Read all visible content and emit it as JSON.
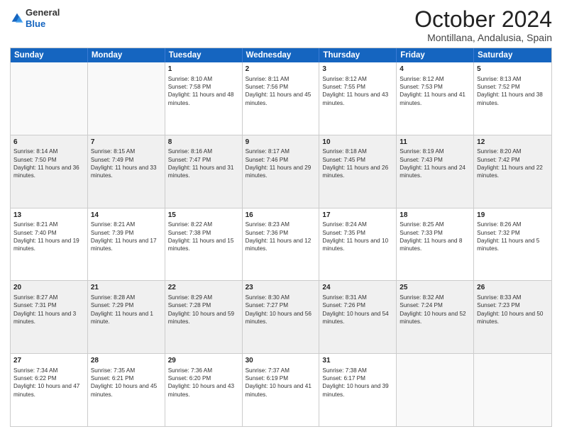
{
  "header": {
    "logo_general": "General",
    "logo_blue": "Blue",
    "month_title": "October 2024",
    "location": "Montillana, Andalusia, Spain"
  },
  "days_of_week": [
    "Sunday",
    "Monday",
    "Tuesday",
    "Wednesday",
    "Thursday",
    "Friday",
    "Saturday"
  ],
  "weeks": [
    [
      {
        "day": "",
        "sunrise": "",
        "sunset": "",
        "daylight": "",
        "shaded": false,
        "empty": true
      },
      {
        "day": "",
        "sunrise": "",
        "sunset": "",
        "daylight": "",
        "shaded": false,
        "empty": true
      },
      {
        "day": "1",
        "sunrise": "Sunrise: 8:10 AM",
        "sunset": "Sunset: 7:58 PM",
        "daylight": "Daylight: 11 hours and 48 minutes.",
        "shaded": false,
        "empty": false
      },
      {
        "day": "2",
        "sunrise": "Sunrise: 8:11 AM",
        "sunset": "Sunset: 7:56 PM",
        "daylight": "Daylight: 11 hours and 45 minutes.",
        "shaded": false,
        "empty": false
      },
      {
        "day": "3",
        "sunrise": "Sunrise: 8:12 AM",
        "sunset": "Sunset: 7:55 PM",
        "daylight": "Daylight: 11 hours and 43 minutes.",
        "shaded": false,
        "empty": false
      },
      {
        "day": "4",
        "sunrise": "Sunrise: 8:12 AM",
        "sunset": "Sunset: 7:53 PM",
        "daylight": "Daylight: 11 hours and 41 minutes.",
        "shaded": false,
        "empty": false
      },
      {
        "day": "5",
        "sunrise": "Sunrise: 8:13 AM",
        "sunset": "Sunset: 7:52 PM",
        "daylight": "Daylight: 11 hours and 38 minutes.",
        "shaded": false,
        "empty": false
      }
    ],
    [
      {
        "day": "6",
        "sunrise": "Sunrise: 8:14 AM",
        "sunset": "Sunset: 7:50 PM",
        "daylight": "Daylight: 11 hours and 36 minutes.",
        "shaded": true,
        "empty": false
      },
      {
        "day": "7",
        "sunrise": "Sunrise: 8:15 AM",
        "sunset": "Sunset: 7:49 PM",
        "daylight": "Daylight: 11 hours and 33 minutes.",
        "shaded": true,
        "empty": false
      },
      {
        "day": "8",
        "sunrise": "Sunrise: 8:16 AM",
        "sunset": "Sunset: 7:47 PM",
        "daylight": "Daylight: 11 hours and 31 minutes.",
        "shaded": true,
        "empty": false
      },
      {
        "day": "9",
        "sunrise": "Sunrise: 8:17 AM",
        "sunset": "Sunset: 7:46 PM",
        "daylight": "Daylight: 11 hours and 29 minutes.",
        "shaded": true,
        "empty": false
      },
      {
        "day": "10",
        "sunrise": "Sunrise: 8:18 AM",
        "sunset": "Sunset: 7:45 PM",
        "daylight": "Daylight: 11 hours and 26 minutes.",
        "shaded": true,
        "empty": false
      },
      {
        "day": "11",
        "sunrise": "Sunrise: 8:19 AM",
        "sunset": "Sunset: 7:43 PM",
        "daylight": "Daylight: 11 hours and 24 minutes.",
        "shaded": true,
        "empty": false
      },
      {
        "day": "12",
        "sunrise": "Sunrise: 8:20 AM",
        "sunset": "Sunset: 7:42 PM",
        "daylight": "Daylight: 11 hours and 22 minutes.",
        "shaded": true,
        "empty": false
      }
    ],
    [
      {
        "day": "13",
        "sunrise": "Sunrise: 8:21 AM",
        "sunset": "Sunset: 7:40 PM",
        "daylight": "Daylight: 11 hours and 19 minutes.",
        "shaded": false,
        "empty": false
      },
      {
        "day": "14",
        "sunrise": "Sunrise: 8:21 AM",
        "sunset": "Sunset: 7:39 PM",
        "daylight": "Daylight: 11 hours and 17 minutes.",
        "shaded": false,
        "empty": false
      },
      {
        "day": "15",
        "sunrise": "Sunrise: 8:22 AM",
        "sunset": "Sunset: 7:38 PM",
        "daylight": "Daylight: 11 hours and 15 minutes.",
        "shaded": false,
        "empty": false
      },
      {
        "day": "16",
        "sunrise": "Sunrise: 8:23 AM",
        "sunset": "Sunset: 7:36 PM",
        "daylight": "Daylight: 11 hours and 12 minutes.",
        "shaded": false,
        "empty": false
      },
      {
        "day": "17",
        "sunrise": "Sunrise: 8:24 AM",
        "sunset": "Sunset: 7:35 PM",
        "daylight": "Daylight: 11 hours and 10 minutes.",
        "shaded": false,
        "empty": false
      },
      {
        "day": "18",
        "sunrise": "Sunrise: 8:25 AM",
        "sunset": "Sunset: 7:33 PM",
        "daylight": "Daylight: 11 hours and 8 minutes.",
        "shaded": false,
        "empty": false
      },
      {
        "day": "19",
        "sunrise": "Sunrise: 8:26 AM",
        "sunset": "Sunset: 7:32 PM",
        "daylight": "Daylight: 11 hours and 5 minutes.",
        "shaded": false,
        "empty": false
      }
    ],
    [
      {
        "day": "20",
        "sunrise": "Sunrise: 8:27 AM",
        "sunset": "Sunset: 7:31 PM",
        "daylight": "Daylight: 11 hours and 3 minutes.",
        "shaded": true,
        "empty": false
      },
      {
        "day": "21",
        "sunrise": "Sunrise: 8:28 AM",
        "sunset": "Sunset: 7:29 PM",
        "daylight": "Daylight: 11 hours and 1 minute.",
        "shaded": true,
        "empty": false
      },
      {
        "day": "22",
        "sunrise": "Sunrise: 8:29 AM",
        "sunset": "Sunset: 7:28 PM",
        "daylight": "Daylight: 10 hours and 59 minutes.",
        "shaded": true,
        "empty": false
      },
      {
        "day": "23",
        "sunrise": "Sunrise: 8:30 AM",
        "sunset": "Sunset: 7:27 PM",
        "daylight": "Daylight: 10 hours and 56 minutes.",
        "shaded": true,
        "empty": false
      },
      {
        "day": "24",
        "sunrise": "Sunrise: 8:31 AM",
        "sunset": "Sunset: 7:26 PM",
        "daylight": "Daylight: 10 hours and 54 minutes.",
        "shaded": true,
        "empty": false
      },
      {
        "day": "25",
        "sunrise": "Sunrise: 8:32 AM",
        "sunset": "Sunset: 7:24 PM",
        "daylight": "Daylight: 10 hours and 52 minutes.",
        "shaded": true,
        "empty": false
      },
      {
        "day": "26",
        "sunrise": "Sunrise: 8:33 AM",
        "sunset": "Sunset: 7:23 PM",
        "daylight": "Daylight: 10 hours and 50 minutes.",
        "shaded": true,
        "empty": false
      }
    ],
    [
      {
        "day": "27",
        "sunrise": "Sunrise: 7:34 AM",
        "sunset": "Sunset: 6:22 PM",
        "daylight": "Daylight: 10 hours and 47 minutes.",
        "shaded": false,
        "empty": false
      },
      {
        "day": "28",
        "sunrise": "Sunrise: 7:35 AM",
        "sunset": "Sunset: 6:21 PM",
        "daylight": "Daylight: 10 hours and 45 minutes.",
        "shaded": false,
        "empty": false
      },
      {
        "day": "29",
        "sunrise": "Sunrise: 7:36 AM",
        "sunset": "Sunset: 6:20 PM",
        "daylight": "Daylight: 10 hours and 43 minutes.",
        "shaded": false,
        "empty": false
      },
      {
        "day": "30",
        "sunrise": "Sunrise: 7:37 AM",
        "sunset": "Sunset: 6:19 PM",
        "daylight": "Daylight: 10 hours and 41 minutes.",
        "shaded": false,
        "empty": false
      },
      {
        "day": "31",
        "sunrise": "Sunrise: 7:38 AM",
        "sunset": "Sunset: 6:17 PM",
        "daylight": "Daylight: 10 hours and 39 minutes.",
        "shaded": false,
        "empty": false
      },
      {
        "day": "",
        "sunrise": "",
        "sunset": "",
        "daylight": "",
        "shaded": false,
        "empty": true
      },
      {
        "day": "",
        "sunrise": "",
        "sunset": "",
        "daylight": "",
        "shaded": false,
        "empty": true
      }
    ]
  ]
}
